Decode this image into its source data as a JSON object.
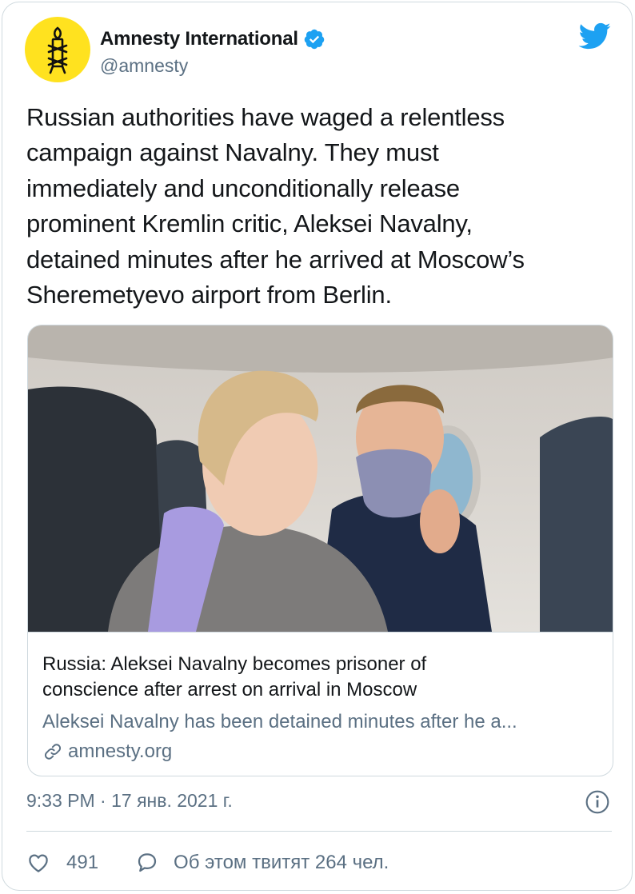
{
  "tweet": {
    "author": {
      "display_name": "Amnesty International",
      "handle": "@amnesty",
      "verified": true,
      "avatar_icon": "amnesty-candle-logo",
      "avatar_color": "#ffe21f"
    },
    "text": "Russian authorities have waged a relentless\ncampaign against Navalny. They must\nimmediately and unconditionally release\nprominent Kremlin critic, Aleksei Navalny,\ndetained minutes after he arrived at Moscow’s\nSheremetyevo airport from Berlin.",
    "link_card": {
      "image": "photo-couple-on-airplane",
      "title": "Russia: Aleksei Navalny becomes prisoner of\nconscience after arrest on arrival in Moscow",
      "description": "Aleksei Navalny has been detained minutes after he a...",
      "domain": "amnesty.org",
      "domain_icon": "link-icon"
    },
    "timestamp": "9:33 PM · 17 янв. 2021 г.",
    "likes_count": "491",
    "reply_label": "Об этом твитят 264 чел."
  },
  "icons": {
    "brand": "twitter-bird-icon",
    "verified": "verified-badge-icon",
    "info": "info-icon",
    "like": "heart-icon",
    "reply": "speech-bubble-icon"
  },
  "colors": {
    "twitter_blue": "#1da1f2",
    "secondary_text": "#5b7083",
    "primary_text": "#14171a",
    "border": "#cfd9de"
  }
}
